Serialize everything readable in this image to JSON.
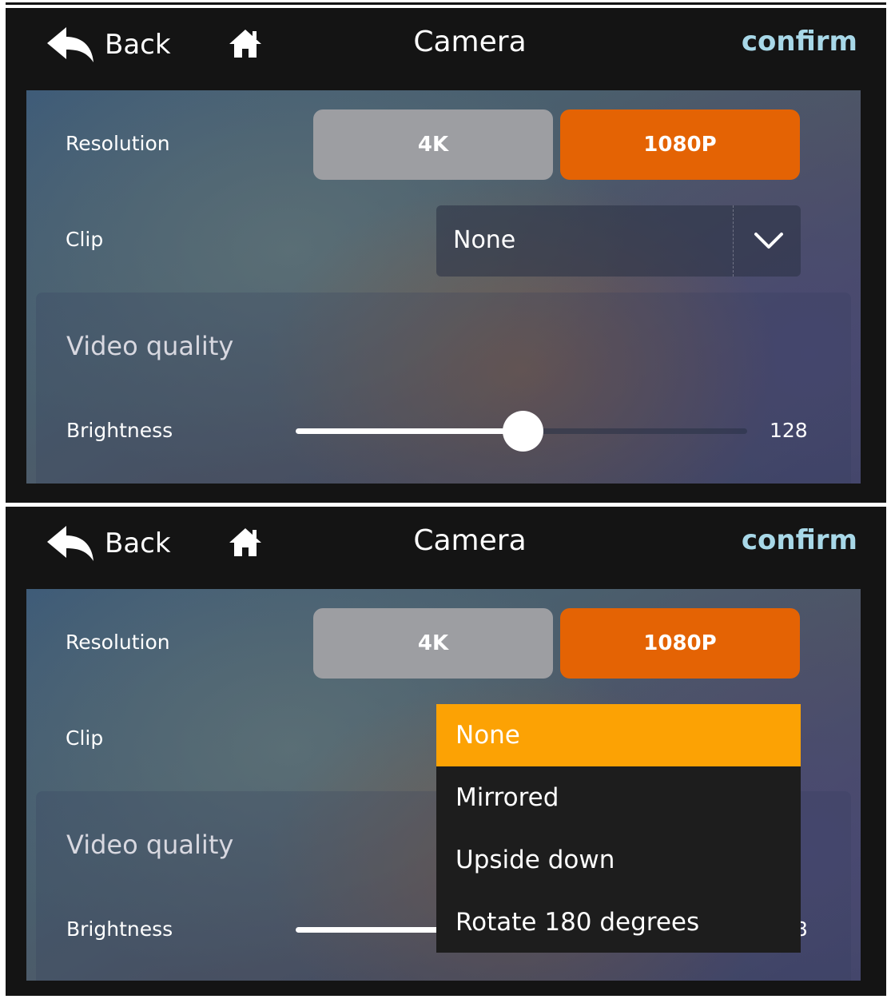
{
  "header": {
    "back_label": "Back",
    "title": "Camera",
    "confirm_label": "confirm"
  },
  "resolution": {
    "label": "Resolution",
    "options": [
      "4K",
      "1080P"
    ],
    "selected": "1080P"
  },
  "clip": {
    "label": "Clip",
    "value": "None",
    "options": [
      "None",
      "Mirrored",
      "Upside down",
      "Rotate 180 degrees"
    ],
    "selected": "None"
  },
  "video_quality": {
    "title": "Video quality",
    "brightness_label": "Brightness",
    "brightness_value": "128",
    "brightness_fraction": 0.502
  },
  "colors": {
    "accent_selected": "#e46304",
    "dropdown_highlight": "#fca204",
    "confirm": "#a8d8e8",
    "unselected": "#9d9ea2"
  },
  "icons": {
    "back": "back-arrow-icon",
    "home": "home-icon",
    "dropdown": "chevron-down-icon"
  }
}
